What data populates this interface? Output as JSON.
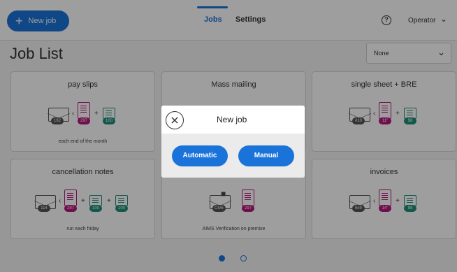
{
  "topbar": {
    "new_job_label": "New job",
    "tabs": [
      {
        "label": "Jobs",
        "active": true
      },
      {
        "label": "Settings",
        "active": false
      }
    ],
    "help_icon": "question-circle-icon",
    "user_label": "Operator"
  },
  "page": {
    "title": "Job List",
    "filter_value": "None"
  },
  "cards": [
    {
      "title": "pay slips",
      "note": "each end of the month",
      "envelope": "162",
      "doc": "297",
      "inserts": [
        "100"
      ]
    },
    {
      "title": "Mass mailing",
      "note": "",
      "envelope": "",
      "doc": "",
      "inserts": []
    },
    {
      "title": "single sheet + BRE",
      "note": "",
      "envelope": "#10",
      "doc": "11\"",
      "inserts": [
        "98"
      ]
    },
    {
      "title": "cancellation notes",
      "note": "run each friday",
      "envelope": "114",
      "doc": "297",
      "inserts": [
        "100",
        "100"
      ]
    },
    {
      "title": "",
      "note": "AIMS Verification on premise",
      "envelope": "C5/6",
      "doc": "297",
      "inserts": []
    },
    {
      "title": "invoices",
      "note": "",
      "envelope": "6x9",
      "doc": "14\"",
      "inserts": [
        "98"
      ]
    }
  ],
  "pager": {
    "pages": 2,
    "current": 1
  },
  "dialog": {
    "title": "New job",
    "automatic_label": "Automatic",
    "manual_label": "Manual"
  },
  "colors": {
    "accent": "#1a73d9",
    "document": "#b5197c",
    "insert": "#1f8f7a"
  }
}
